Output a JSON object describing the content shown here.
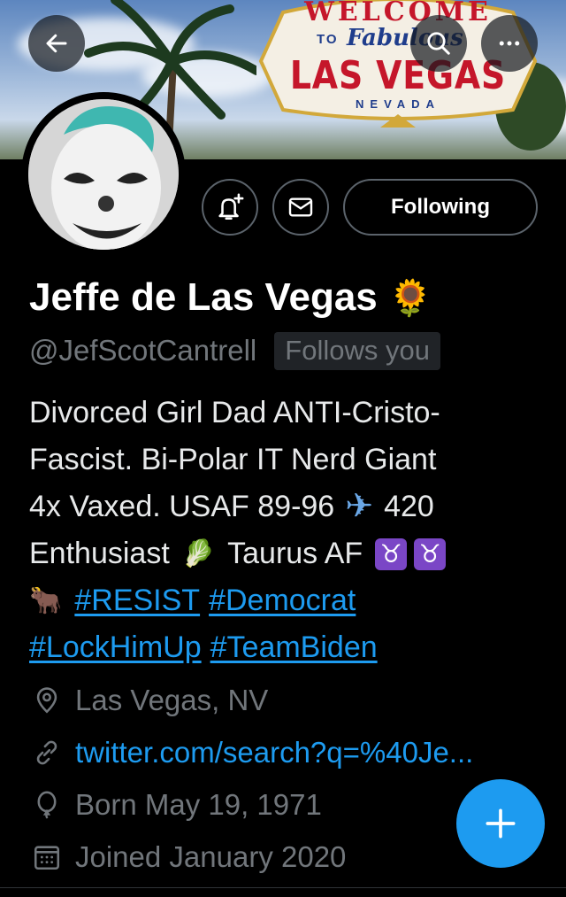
{
  "header": {
    "banner_sign": {
      "welcome": "WELCOME",
      "to": "TO",
      "fabulous": "Fabulous",
      "city": "LAS VEGAS",
      "state": "NEVADA"
    },
    "back_icon": "arrow-left-icon",
    "search_icon": "search-icon",
    "more_icon": "more-horizontal-icon"
  },
  "actions": {
    "notify_icon": "bell-plus-icon",
    "message_icon": "envelope-icon",
    "follow_label": "Following"
  },
  "profile": {
    "display_name": "Jeffe de Las Vegas",
    "name_emoji": "🌻",
    "handle": "@JefScotCantrell",
    "follows_you": "Follows you",
    "bio": {
      "line1": "Divorced Girl Dad ANTI-Cristo-",
      "line2": "Fascist. Bi-Polar IT Nerd Giant",
      "line3a": "4x Vaxed. USAF 89-96",
      "line3_emoji": "✈",
      "line3b": "420",
      "line4a": "Enthusiast",
      "line4_emoji": "🥬",
      "line4b": "Taurus AF",
      "taurus_symbol": "♉",
      "line5_emoji": "🐂",
      "hashtags": [
        "#RESIST",
        "#Democrat",
        "#LockHimUp",
        "#TeamBiden"
      ]
    },
    "location": "Las Vegas, NV",
    "website": "twitter.com/search?q=%40Je...",
    "birthday": "Born May 19, 1971",
    "joined": "Joined January 2020"
  },
  "fab_icon": "plus-icon",
  "colors": {
    "background": "#000000",
    "accent": "#1d9bf0",
    "muted_text": "#71767b",
    "taurus_badge": "#7a46c6"
  }
}
